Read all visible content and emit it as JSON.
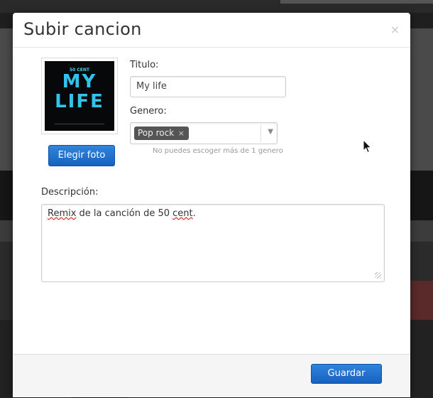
{
  "dialog": {
    "title": "Subir cancion",
    "close_glyph": "×"
  },
  "cover": {
    "artist": "50 CENT",
    "title_line1": "MY",
    "title_line2": "LIFE",
    "choose_photo_label": "Elegir foto"
  },
  "form": {
    "title_label": "Titulo:",
    "title_value": "My life",
    "genre_label": "Genero:",
    "genre_tag": "Pop rock",
    "tag_remove_glyph": "×",
    "genre_help": "No puedes escoger más de 1 genero",
    "description_label": "Descripción:",
    "description_parts": [
      "Remix",
      " de la canción de 50 ",
      "cent",
      "."
    ]
  },
  "footer": {
    "save_label": "Guardar"
  },
  "colors": {
    "primary_button": "#1862c0",
    "tag_background": "#555555",
    "overlay": "#1f1f1f"
  },
  "icons": [
    "close-icon",
    "tag-remove-icon",
    "dropdown-arrow-icon",
    "mouse-cursor-icon",
    "resize-handle-icon"
  ]
}
